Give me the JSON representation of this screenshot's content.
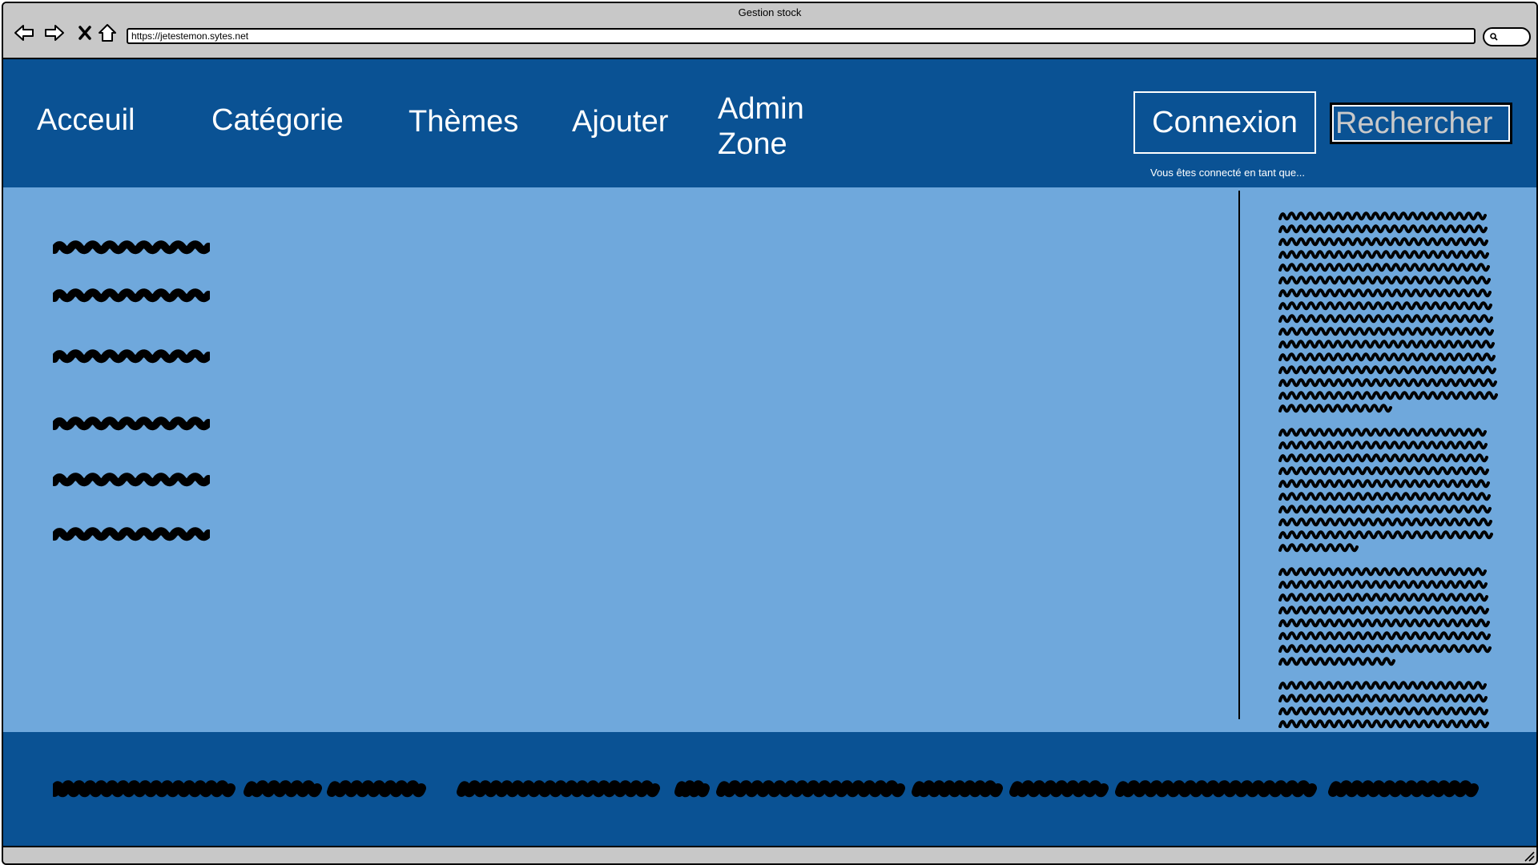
{
  "window": {
    "title": "Gestion stock",
    "url": "https://jetestemon.sytes.net"
  },
  "colors": {
    "header_bg": "#0a5294",
    "main_bg": "#6fa8dc",
    "footer_bg": "#0a5294",
    "chrome_bg": "#c8c8c8"
  },
  "toolbar": {
    "icons": [
      "back-arrow-icon",
      "forward-arrow-icon",
      "close-x-icon",
      "home-icon",
      "search-icon"
    ]
  },
  "nav": {
    "accueil": "Acceuil",
    "categorie": "Catégorie",
    "themes": "Thèmes",
    "ajouter": "Ajouter",
    "admin_line1": "Admin",
    "admin_line2": "Zone"
  },
  "header": {
    "connexion_label": "Connexion",
    "search_placeholder": "Rechercher",
    "logged_in_text": "Vous êtes connecté en tant que..."
  }
}
